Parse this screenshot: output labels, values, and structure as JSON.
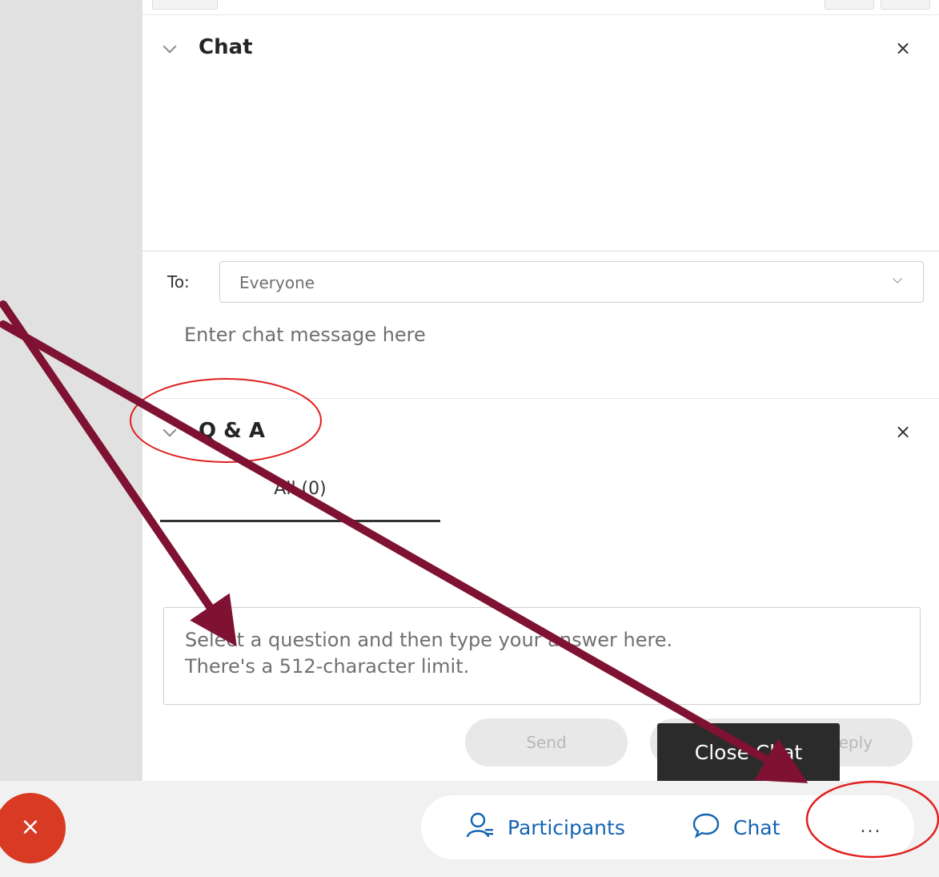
{
  "chat": {
    "title": "Chat",
    "close_symbol": "×",
    "to_label": "To:",
    "to_value": "Everyone",
    "input_placeholder": "Enter chat message here"
  },
  "qa": {
    "title": "Q & A",
    "close_symbol": "×",
    "tab_all_label": "All (0)",
    "answer_placeholder_line1": "Select a question and then type your answer here.",
    "answer_placeholder_line2": "There's a 512-character limit.",
    "send_label": "Send",
    "reply_label": "Reply"
  },
  "tooltip": {
    "text": "Close Chat"
  },
  "toolbar": {
    "end_symbol": "×",
    "participants_label": "Participants",
    "chat_label": "Chat",
    "more_label": "..."
  },
  "colors": {
    "accent_blue": "#1464b4",
    "end_red": "#d93a23",
    "annotation_arrow": "#7f1133",
    "annotation_circle": "#e02020"
  }
}
